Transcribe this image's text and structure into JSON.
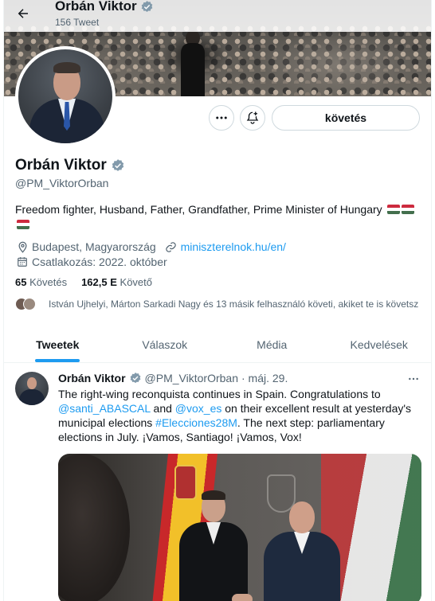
{
  "header": {
    "name": "Orbán Viktor",
    "tweet_count": "156 Tweet"
  },
  "actions": {
    "follow_label": "követés"
  },
  "profile": {
    "name": "Orbán Viktor",
    "handle": "@PM_ViktorOrban",
    "bio": "Freedom fighter, Husband, Father, Grandfather, Prime Minister of Hungary",
    "location": "Budapest, Magyarország",
    "website": "miniszterelnok.hu/en/",
    "joined": "Csatlakozás: 2022. október",
    "following_count": "65",
    "following_label": "Követés",
    "followers_count": "162,5 E",
    "followers_label": "Követő",
    "known_followers": "István Ujhelyi, Márton Sarkadi Nagy és 13 másik felhasználó követi, akiket te is követsz"
  },
  "tabs": [
    {
      "label": "Tweetek",
      "active": true
    },
    {
      "label": "Válaszok",
      "active": false
    },
    {
      "label": "Média",
      "active": false
    },
    {
      "label": "Kedvelések",
      "active": false
    }
  ],
  "tweet": {
    "author": "Orbán Viktor",
    "handle": "@PM_ViktorOrban",
    "date": "· máj. 29.",
    "text_1": "The right-wing reconquista continues in Spain. Congratulations to",
    "mention_1": "@santi_ABASCAL",
    "text_2": " and ",
    "mention_2": "@vox_es",
    "text_3": " on their excellent result at yesterday's municipal elections ",
    "hashtag": "#Elecciones28M",
    "text_4": ". The next step: parliamentary elections in July. ¡Vamos, Santiago! ¡Vamos, Vox!"
  },
  "colors": {
    "accent": "#1d9bf0",
    "verified": "#829aab",
    "secondary_text": "#536471"
  },
  "icons": {
    "back": "arrow-left-icon",
    "verified": "verified-badge-icon",
    "more": "more-horizontal-icon",
    "notify": "bell-plus-icon",
    "location": "location-pin-icon",
    "link": "link-icon",
    "calendar": "calendar-icon"
  }
}
